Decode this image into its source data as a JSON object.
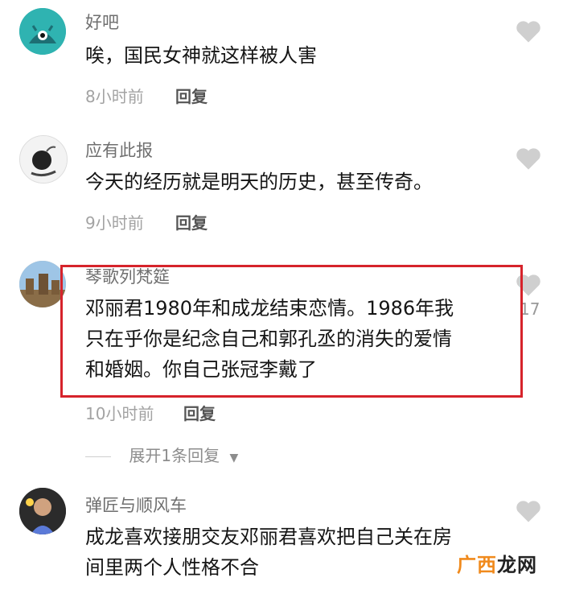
{
  "comments": [
    {
      "username": "好吧",
      "text": [
        "唉，国民女神就这样被人害"
      ],
      "time": "8小时前",
      "reply_label": "回复"
    },
    {
      "username": "应有此报",
      "text": [
        "今天的经历就是明天的历史，甚至传奇。"
      ],
      "time": "9小时前",
      "reply_label": "回复"
    },
    {
      "username": "琴歌列梵筵",
      "text": [
        "邓丽君1980年和成龙结束恋情。1986年我",
        "只在乎你是纪念自己和郭孔丞的消失的爱情",
        "和婚姻。你自己张冠李戴了"
      ],
      "time": "10小时前",
      "reply_label": "回复",
      "like_count": "17",
      "expand_label": "展开1条回复"
    },
    {
      "username": "弹匠与顺风车",
      "text": [
        "成龙喜欢接朋交友邓丽君喜欢把自己关在房",
        "间里两个人性格不合"
      ]
    }
  ],
  "watermark": {
    "part1": "广西",
    "part2": "龙网"
  },
  "icons": {
    "like": "heart-icon",
    "expand": "caret-down-icon"
  },
  "colors": {
    "highlight_border": "#d6232b",
    "watermark_orange": "#f08a1d",
    "heart_gray": "#cfcfcf"
  }
}
